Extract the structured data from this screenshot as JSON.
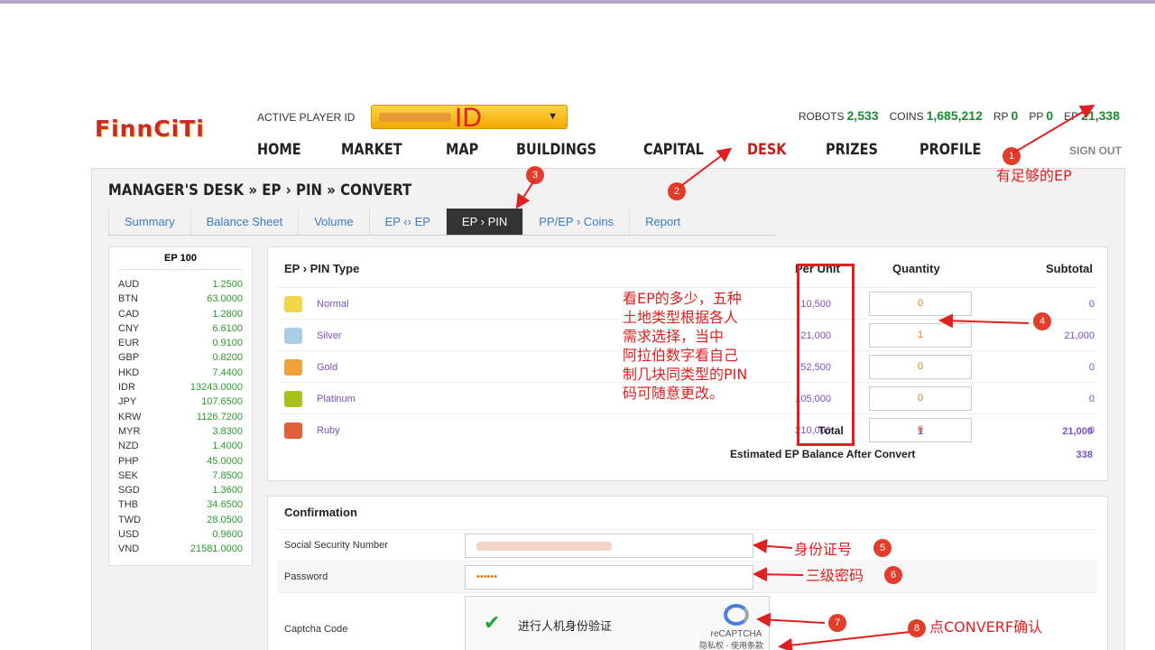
{
  "header": {
    "logo_text": "FinnCiTi",
    "active_player_label": "ACTIVE PLAYER ID",
    "player_id_overlay": "ID",
    "stats": [
      {
        "label": "ROBOTS",
        "value": "2,533"
      },
      {
        "label": "COINS",
        "value": "1,685,212"
      },
      {
        "label": "RP",
        "value": "0"
      },
      {
        "label": "PP",
        "value": "0"
      },
      {
        "label": "EP",
        "value": "21,338"
      }
    ],
    "nav": [
      "HOME",
      "MARKET",
      "MAP",
      "BUILDINGS",
      "CAPITAL",
      "DESK",
      "PRIZES",
      "PROFILE"
    ],
    "active_nav": "DESK",
    "sign_out": "SIGN OUT"
  },
  "breadcrumb": "MANAGER'S DESK » EP › PIN » CONVERT",
  "tabs": [
    "Summary",
    "Balance Sheet",
    "Volume",
    "EP ‹› EP",
    "EP › PIN",
    "PP/EP › Coins",
    "Report"
  ],
  "active_tab": "EP › PIN",
  "rates": {
    "header": "EP 100",
    "items": [
      {
        "code": "AUD",
        "value": "1.2500"
      },
      {
        "code": "BTN",
        "value": "63.0000"
      },
      {
        "code": "CAD",
        "value": "1.2800"
      },
      {
        "code": "CNY",
        "value": "6.6100"
      },
      {
        "code": "EUR",
        "value": "0.9100"
      },
      {
        "code": "GBP",
        "value": "0.8200"
      },
      {
        "code": "HKD",
        "value": "7.4400"
      },
      {
        "code": "IDR",
        "value": "13243.0000"
      },
      {
        "code": "JPY",
        "value": "107.6500"
      },
      {
        "code": "KRW",
        "value": "1126.7200"
      },
      {
        "code": "MYR",
        "value": "3.8300"
      },
      {
        "code": "NZD",
        "value": "1.4000"
      },
      {
        "code": "PHP",
        "value": "45.0000"
      },
      {
        "code": "SEK",
        "value": "7.8500"
      },
      {
        "code": "SGD",
        "value": "1.3600"
      },
      {
        "code": "THB",
        "value": "34.6500"
      },
      {
        "code": "TWD",
        "value": "28.0500"
      },
      {
        "code": "USD",
        "value": "0.9600"
      },
      {
        "code": "VND",
        "value": "21581.0000"
      }
    ]
  },
  "pin_table": {
    "headers": {
      "type": "EP › PIN Type",
      "per_unit": "Per Unit",
      "quantity": "Quantity",
      "subtotal": "Subtotal"
    },
    "rows": [
      {
        "name": "Normal",
        "per_unit": "10,500",
        "quantity": "0",
        "subtotal": "0",
        "color": "#f2d64a"
      },
      {
        "name": "Silver",
        "per_unit": "21,000",
        "quantity": "1",
        "subtotal": "21,000",
        "color": "#a9cfe8"
      },
      {
        "name": "Gold",
        "per_unit": "52,500",
        "quantity": "0",
        "subtotal": "0",
        "color": "#f0a23a"
      },
      {
        "name": "Platinum",
        "per_unit": "105,000",
        "quantity": "0",
        "subtotal": "0",
        "color": "#a8c21a"
      },
      {
        "name": "Ruby",
        "per_unit": "210,000",
        "quantity": "0",
        "subtotal": "0",
        "color": "#e0603a"
      }
    ],
    "total_label": "Total",
    "total_quantity": "1",
    "total_subtotal": "21,000",
    "estimate_label": "Estimated EP Balance After Convert",
    "estimate_value": "338"
  },
  "confirmation": {
    "title": "Confirmation",
    "ssn_label": "Social Security Number",
    "password_label": "Password",
    "password_value": "••••••",
    "captcha_label": "Captcha Code",
    "captcha_text": "进行人机身份验证",
    "recaptcha": "reCAPTCHA",
    "recaptcha_terms": "隐私权 - 使用条款"
  },
  "annotations": {
    "enough_ep": "有足够的EP",
    "explain": [
      "看EP的多少，五种",
      "土地类型根据各人",
      "需求选择，当中",
      "阿拉伯数字看自己",
      "制几块同类型的PIN",
      "码可随意更改。"
    ],
    "id_number": "身份证号",
    "level3_password": "三级密码",
    "click_convert": "点CONVERF确认",
    "badges": [
      "1",
      "2",
      "3",
      "4",
      "5",
      "6",
      "7",
      "8"
    ]
  }
}
